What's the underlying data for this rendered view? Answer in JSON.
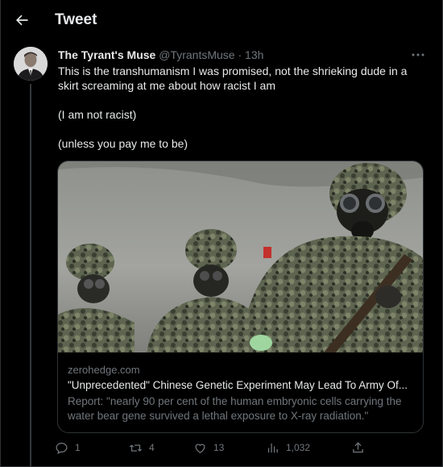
{
  "header": {
    "title": "Tweet",
    "back_icon": "arrow-left-icon"
  },
  "tweet": {
    "display_name": "The Tyrant's Muse",
    "handle": "@TyrantsMuse",
    "separator": "·",
    "time": "13h",
    "text_lines": [
      "This is the transhumanism I was promised, not the shrieking dude in a skirt screaming at me about how racist I am",
      "(I am not racist)",
      "(unless you pay me to be)"
    ]
  },
  "card": {
    "domain": "zerohedge.com",
    "title": "\"Unprecedented\" Chinese Genetic Experiment May Lead To Army Of...",
    "description": "Report: \"nearly 90 per cent of the human embryonic cells carrying the water bear gene survived a lethal exposure to X-ray radiation.\""
  },
  "actions": {
    "replies": "1",
    "retweets": "4",
    "likes": "13",
    "views": "1,032"
  },
  "colors": {
    "background": "#000000",
    "text": "#e7e9ea",
    "muted": "#71767b",
    "border": "#2f3336"
  }
}
